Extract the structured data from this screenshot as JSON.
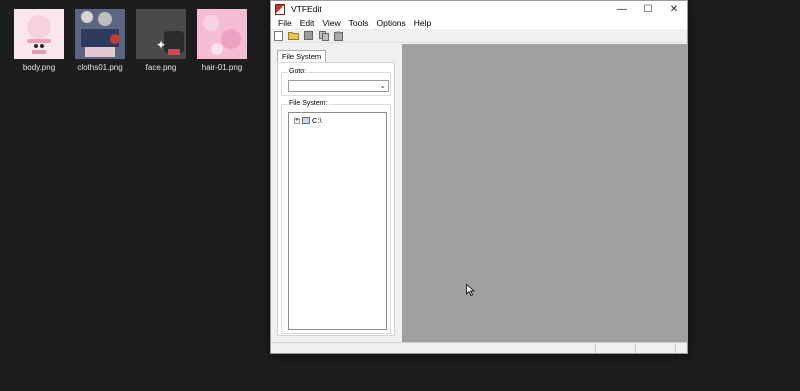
{
  "desktop": {
    "files": [
      {
        "name": "body.png"
      },
      {
        "name": "cloths01.png"
      },
      {
        "name": "face.png"
      },
      {
        "name": "hair-01.png"
      }
    ]
  },
  "window": {
    "title": "VTFEdit",
    "controls": [
      "—",
      "☐",
      "✕"
    ],
    "menu": [
      "File",
      "Edit",
      "View",
      "Tools",
      "Options",
      "Help"
    ],
    "toolbar_icons": [
      "new-icon",
      "open-icon",
      "save-icon",
      "copy-icon",
      "paste-icon"
    ],
    "tab_label": "File System",
    "goto_label": "Goto:",
    "goto_value": "",
    "filesystem_label": "File System:",
    "tree_root": "C:\\",
    "tree_expander": "+"
  }
}
